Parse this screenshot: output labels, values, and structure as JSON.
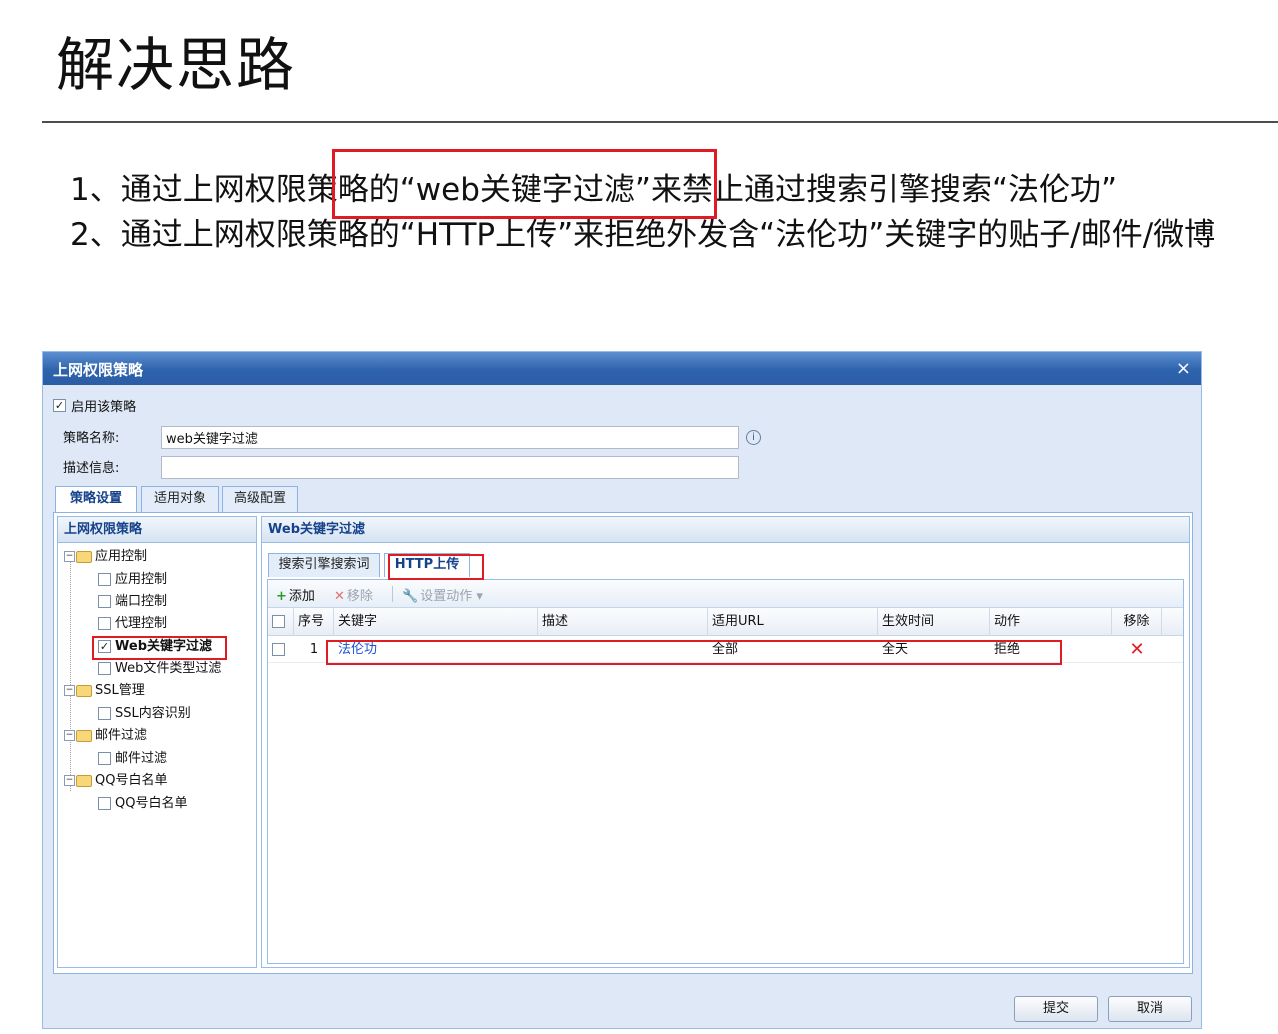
{
  "slide": {
    "title": "解决思路",
    "points": [
      "1、通过上网权限策略的“web关键字过滤”来禁止通过搜索引擎搜索“法伦功”",
      "2、通过上网权限策略的“HTTP上传”来拒绝外发含“法伦功”关键字的贴子/邮件/微博"
    ]
  },
  "dialog": {
    "title": "上网权限策略",
    "close_glyph": "×",
    "enable_label": "启用该策略",
    "enable_checked": true,
    "name_label": "策略名称:",
    "name_value": "web关键字过滤",
    "desc_label": "描述信息:",
    "desc_value": "",
    "info_glyph": "i",
    "tabs": [
      {
        "label": "策略设置",
        "active": true
      },
      {
        "label": "适用对象",
        "active": false
      },
      {
        "label": "高级配置",
        "active": false
      }
    ],
    "tree": {
      "header": "上网权限策略",
      "groups": [
        {
          "label": "应用控制",
          "children": [
            "应用控制",
            "端口控制",
            "代理控制",
            "Web关键字过滤",
            "Web文件类型过滤"
          ]
        },
        {
          "label": "SSL管理",
          "children": [
            "SSL内容识别"
          ]
        },
        {
          "label": "邮件过滤",
          "children": [
            "邮件过滤"
          ]
        },
        {
          "label": "QQ号白名单",
          "children": [
            "QQ号白名单"
          ]
        }
      ],
      "selected": "Web关键字过滤"
    },
    "right_panel": {
      "header": "Web关键字过滤",
      "subtabs": [
        {
          "label": "搜索引擎搜索词",
          "active": false
        },
        {
          "label": "HTTP上传",
          "active": true
        }
      ],
      "toolbar": {
        "add": "添加",
        "remove": "移除",
        "set_action": "设置动作"
      },
      "columns": [
        "序号",
        "关键字",
        "描述",
        "适用URL",
        "生效时间",
        "动作",
        "移除"
      ],
      "rows": [
        {
          "index": "1",
          "keyword": "法伦功",
          "desc": "",
          "url": "全部",
          "time": "全天",
          "action": "拒绝"
        }
      ]
    },
    "submit_label": "提交",
    "cancel_label": "取消"
  },
  "colors": {
    "highlight": "#e01b24",
    "titlebar": "#2e63ad",
    "link": "#1a4fd6"
  }
}
